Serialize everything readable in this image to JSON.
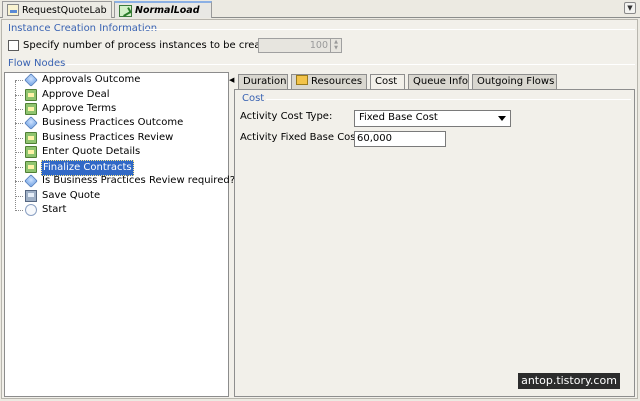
{
  "editor_tabs": [
    {
      "label": "RequestQuoteLab",
      "icon": "document-icon"
    },
    {
      "label": "NormalLoad",
      "icon": "flow-icon",
      "active": true
    }
  ],
  "instance_group": {
    "title": "Instance Creation Information",
    "checkbox_label": "Specify number of process instances to be created",
    "checked": false,
    "instances_value": "100"
  },
  "flow_nodes": {
    "title": "Flow Nodes",
    "items": [
      {
        "label": "Approvals Outcome",
        "icon": "gateway-icon"
      },
      {
        "label": "Approve Deal",
        "icon": "task-icon"
      },
      {
        "label": "Approve Terms",
        "icon": "task-icon"
      },
      {
        "label": "Business Practices Outcome",
        "icon": "gateway-icon"
      },
      {
        "label": "Business Practices Review",
        "icon": "task-icon"
      },
      {
        "label": "Enter Quote Details",
        "icon": "task-icon"
      },
      {
        "label": "Finalize Contracts",
        "icon": "task-icon",
        "selected": true
      },
      {
        "label": "Is Business Practices Review required?",
        "icon": "gateway-icon"
      },
      {
        "label": "Save Quote",
        "icon": "save-icon"
      },
      {
        "label": "Start",
        "icon": "start-icon"
      }
    ]
  },
  "detail_tabs": [
    {
      "label": "Duration"
    },
    {
      "label": "Resources",
      "icon": "folder-icon"
    },
    {
      "label": "Cost",
      "active": true
    },
    {
      "label": "Queue Info"
    },
    {
      "label": "Outgoing Flows"
    }
  ],
  "cost": {
    "group_title": "Cost",
    "type_label": "Activity Cost Type:",
    "type_value": "Fixed Base Cost",
    "fixed_label": "Activity Fixed Base Cost:",
    "fixed_value": "60,000"
  },
  "watermark": "antop.tistory.com",
  "colors": {
    "group_title": "#3a63b3",
    "selection": "#3169c6"
  }
}
